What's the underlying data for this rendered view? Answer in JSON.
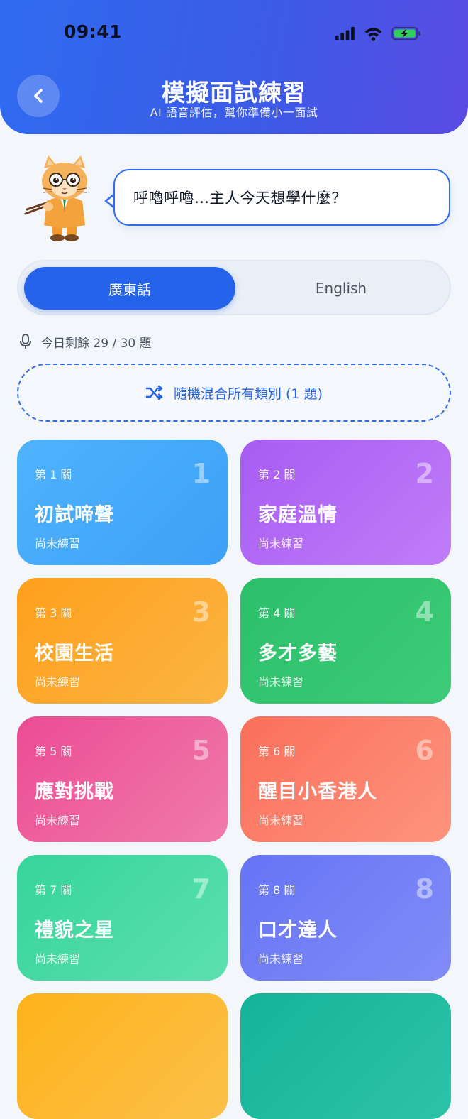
{
  "status_bar": {
    "time": "09:41"
  },
  "header": {
    "title": "模擬面試練習",
    "subtitle": "AI 語音評估，幫你準備小一面試"
  },
  "mascot": {
    "speech": "呼嚕呼嚕…主人今天想學什麼？"
  },
  "language_toggle": {
    "options": [
      "廣東話",
      "English"
    ],
    "selected": "廣東話"
  },
  "remaining": {
    "text": "今日剩餘 29 / 30 題"
  },
  "random_mix": {
    "label": "隨機混合所有類別 (1 題)"
  },
  "levels": [
    {
      "level_label": "第 1 關",
      "number": "1",
      "name": "初試啼聲",
      "status": "尚未練習",
      "gradient": [
        "#4FB3FF",
        "#3DA0F5"
      ]
    },
    {
      "level_label": "第 2 關",
      "number": "2",
      "name": "家庭溫情",
      "status": "尚未練習",
      "gradient": [
        "#A75CF3",
        "#C07DF8"
      ]
    },
    {
      "level_label": "第 3 關",
      "number": "3",
      "name": "校園生活",
      "status": "尚未練習",
      "gradient": [
        "#FF9F1C",
        "#FBB544"
      ]
    },
    {
      "level_label": "第 4 關",
      "number": "4",
      "name": "多才多藝",
      "status": "尚未練習",
      "gradient": [
        "#2CC06A",
        "#3DCB78"
      ]
    },
    {
      "level_label": "第 5 關",
      "number": "5",
      "name": "應對挑戰",
      "status": "尚未練習",
      "gradient": [
        "#EC4C94",
        "#F07AAB"
      ]
    },
    {
      "level_label": "第 6 關",
      "number": "6",
      "name": "醒目小香港人",
      "status": "尚未練習",
      "gradient": [
        "#FB6F5A",
        "#FD947E"
      ]
    },
    {
      "level_label": "第 7 關",
      "number": "7",
      "name": "禮貌之星",
      "status": "尚未練習",
      "gradient": [
        "#36D49B",
        "#5CE0B0"
      ]
    },
    {
      "level_label": "第 8 關",
      "number": "8",
      "name": "口才達人",
      "status": "尚未練習",
      "gradient": [
        "#6674F5",
        "#818CF8"
      ]
    }
  ],
  "colors": {
    "primary": "#2563EB",
    "background": "#F3F6FB"
  }
}
